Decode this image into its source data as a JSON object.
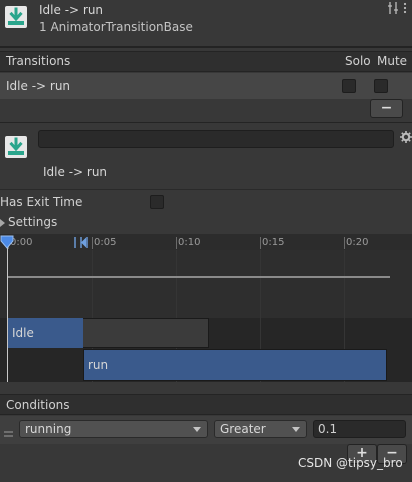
{
  "header": {
    "title": "Idle -> run",
    "subtitle": "1 AnimatorTransitionBase"
  },
  "transitions": {
    "heading": "Transitions",
    "col_solo": "Solo",
    "col_mute": "Mute",
    "rows": [
      {
        "label": "Idle -> run",
        "solo": false,
        "mute": false
      }
    ],
    "remove_label": "−"
  },
  "transition": {
    "name_value": "",
    "label": "Idle -> run",
    "has_exit_time_label": "Has Exit Time",
    "has_exit_time": false,
    "settings_label": "Settings"
  },
  "timeline": {
    "ticks": [
      "0:00",
      "0:05",
      "0:10",
      "0:15",
      "0:20"
    ],
    "state_from": "Idle",
    "state_to": "run"
  },
  "conditions": {
    "heading": "Conditions",
    "items": [
      {
        "parameter": "running",
        "mode": "Greater",
        "value": "0.1"
      }
    ],
    "add_label": "+",
    "remove_label": "−"
  },
  "watermark": "CSDN @tipsy_bro",
  "colors": {
    "accent_blue": "#3a5a8c",
    "panel_bg": "#383838"
  }
}
